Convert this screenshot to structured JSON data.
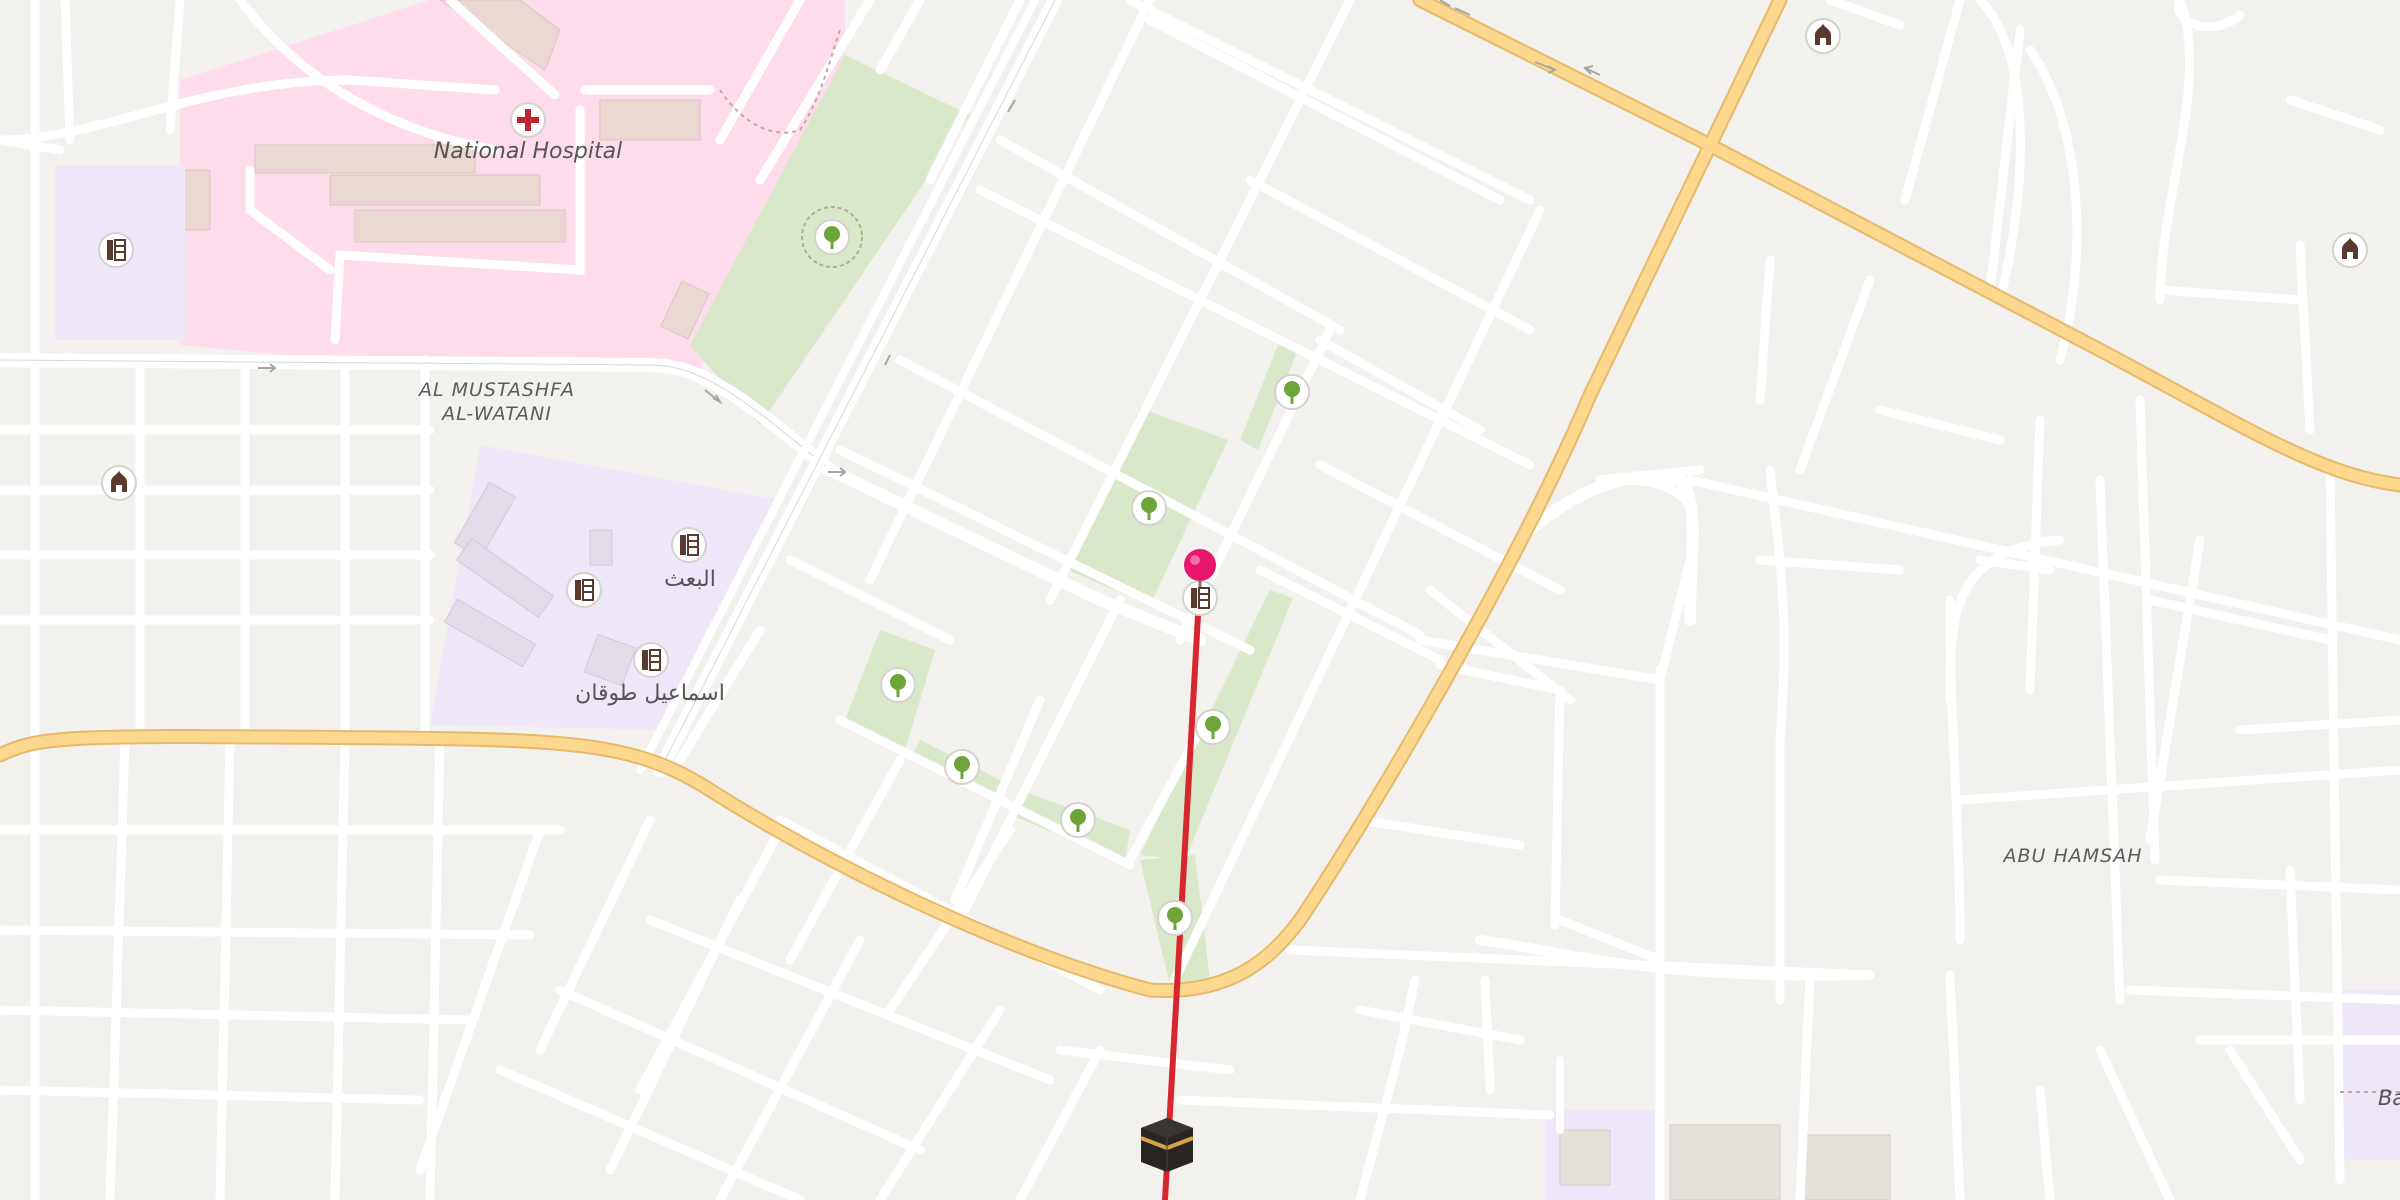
{
  "map": {
    "labels": {
      "hospital": "National Hospital",
      "district_1_line1": "AL MUSTASHFA",
      "district_1_line2": "AL-WATANI",
      "district_2": "ABU HAMSAH",
      "school_1": "البعث",
      "school_2": "اسماعيل طوقان",
      "edge_label": "Ba"
    },
    "icons": {
      "hospital": "hospital-cross-icon",
      "school": "school-icon",
      "mosque": "mosque-icon",
      "park": "tree-icon",
      "kaaba": "kaaba-icon",
      "pin": "location-pin-icon"
    },
    "colors": {
      "background": "#f3f1ee",
      "road": "#ffffff",
      "major_road": "#fbd88e",
      "park": "#d8e8c8",
      "hospital_area": "#ffdcec",
      "school_area": "#eee7f8",
      "route_line": "#d8262f",
      "pin": "#e8176b"
    }
  }
}
